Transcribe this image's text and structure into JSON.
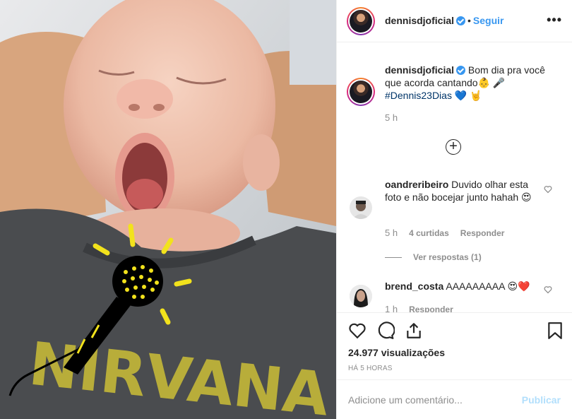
{
  "post": {
    "author": "dennisdjoficial",
    "follow_label": "Seguir",
    "separator": "•",
    "more_label": "•••"
  },
  "caption": {
    "username": "dennisdjoficial",
    "text": "Bom dia pra você que acorda cantando👶 🎤",
    "hashtag": "#Dennis23Dias",
    "emojis": "💙 🤘",
    "time": "5 h"
  },
  "comments": [
    {
      "username": "oandreribeiro",
      "text": "Duvido olhar esta foto e não bocejar junto hahah 😍",
      "time": "5 h",
      "likes": "4 curtidas",
      "reply_label": "Responder",
      "replies_label": "Ver respostas (1)"
    },
    {
      "username": "brend_costa",
      "text": "AAAAAAAAA 😍❤️",
      "time": "1 h",
      "reply_label": "Responder"
    }
  ],
  "stats": {
    "views": "24.977 visualizações",
    "ago": "HÁ 5 HORAS"
  },
  "add_comment": {
    "placeholder": "Adicione um comentário...",
    "publish_label": "Publicar"
  },
  "colors": {
    "accent": "#3897f0",
    "hashtag": "#003569",
    "muted": "#8e8e8e",
    "publish_disabled": "#b2dffc",
    "mic_yellow": "#f2e21c"
  },
  "icons": [
    "heart-icon",
    "comment-icon",
    "share-icon",
    "bookmark-icon",
    "plus-circle-icon",
    "verified-badge-icon",
    "more-icon"
  ]
}
